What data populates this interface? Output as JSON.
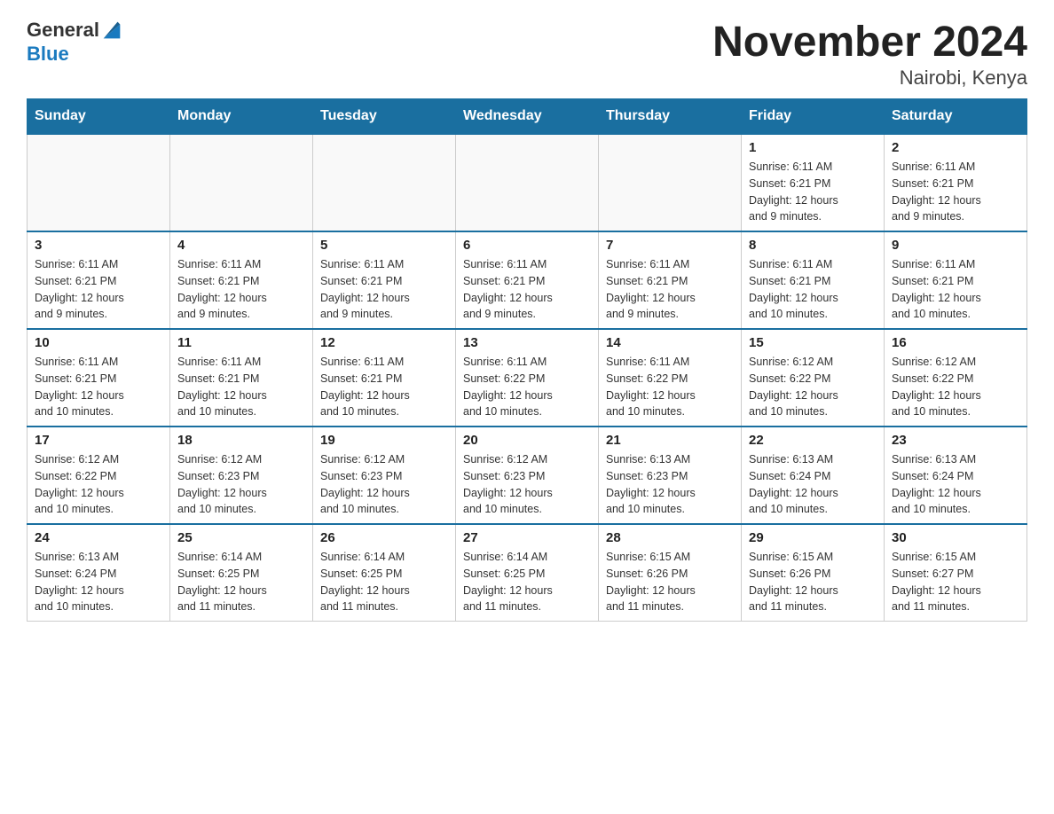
{
  "header": {
    "title": "November 2024",
    "subtitle": "Nairobi, Kenya"
  },
  "logo": {
    "general": "General",
    "blue": "Blue"
  },
  "weekdays": [
    "Sunday",
    "Monday",
    "Tuesday",
    "Wednesday",
    "Thursday",
    "Friday",
    "Saturday"
  ],
  "weeks": [
    [
      {
        "day": "",
        "info": ""
      },
      {
        "day": "",
        "info": ""
      },
      {
        "day": "",
        "info": ""
      },
      {
        "day": "",
        "info": ""
      },
      {
        "day": "",
        "info": ""
      },
      {
        "day": "1",
        "info": "Sunrise: 6:11 AM\nSunset: 6:21 PM\nDaylight: 12 hours\nand 9 minutes."
      },
      {
        "day": "2",
        "info": "Sunrise: 6:11 AM\nSunset: 6:21 PM\nDaylight: 12 hours\nand 9 minutes."
      }
    ],
    [
      {
        "day": "3",
        "info": "Sunrise: 6:11 AM\nSunset: 6:21 PM\nDaylight: 12 hours\nand 9 minutes."
      },
      {
        "day": "4",
        "info": "Sunrise: 6:11 AM\nSunset: 6:21 PM\nDaylight: 12 hours\nand 9 minutes."
      },
      {
        "day": "5",
        "info": "Sunrise: 6:11 AM\nSunset: 6:21 PM\nDaylight: 12 hours\nand 9 minutes."
      },
      {
        "day": "6",
        "info": "Sunrise: 6:11 AM\nSunset: 6:21 PM\nDaylight: 12 hours\nand 9 minutes."
      },
      {
        "day": "7",
        "info": "Sunrise: 6:11 AM\nSunset: 6:21 PM\nDaylight: 12 hours\nand 9 minutes."
      },
      {
        "day": "8",
        "info": "Sunrise: 6:11 AM\nSunset: 6:21 PM\nDaylight: 12 hours\nand 10 minutes."
      },
      {
        "day": "9",
        "info": "Sunrise: 6:11 AM\nSunset: 6:21 PM\nDaylight: 12 hours\nand 10 minutes."
      }
    ],
    [
      {
        "day": "10",
        "info": "Sunrise: 6:11 AM\nSunset: 6:21 PM\nDaylight: 12 hours\nand 10 minutes."
      },
      {
        "day": "11",
        "info": "Sunrise: 6:11 AM\nSunset: 6:21 PM\nDaylight: 12 hours\nand 10 minutes."
      },
      {
        "day": "12",
        "info": "Sunrise: 6:11 AM\nSunset: 6:21 PM\nDaylight: 12 hours\nand 10 minutes."
      },
      {
        "day": "13",
        "info": "Sunrise: 6:11 AM\nSunset: 6:22 PM\nDaylight: 12 hours\nand 10 minutes."
      },
      {
        "day": "14",
        "info": "Sunrise: 6:11 AM\nSunset: 6:22 PM\nDaylight: 12 hours\nand 10 minutes."
      },
      {
        "day": "15",
        "info": "Sunrise: 6:12 AM\nSunset: 6:22 PM\nDaylight: 12 hours\nand 10 minutes."
      },
      {
        "day": "16",
        "info": "Sunrise: 6:12 AM\nSunset: 6:22 PM\nDaylight: 12 hours\nand 10 minutes."
      }
    ],
    [
      {
        "day": "17",
        "info": "Sunrise: 6:12 AM\nSunset: 6:22 PM\nDaylight: 12 hours\nand 10 minutes."
      },
      {
        "day": "18",
        "info": "Sunrise: 6:12 AM\nSunset: 6:23 PM\nDaylight: 12 hours\nand 10 minutes."
      },
      {
        "day": "19",
        "info": "Sunrise: 6:12 AM\nSunset: 6:23 PM\nDaylight: 12 hours\nand 10 minutes."
      },
      {
        "day": "20",
        "info": "Sunrise: 6:12 AM\nSunset: 6:23 PM\nDaylight: 12 hours\nand 10 minutes."
      },
      {
        "day": "21",
        "info": "Sunrise: 6:13 AM\nSunset: 6:23 PM\nDaylight: 12 hours\nand 10 minutes."
      },
      {
        "day": "22",
        "info": "Sunrise: 6:13 AM\nSunset: 6:24 PM\nDaylight: 12 hours\nand 10 minutes."
      },
      {
        "day": "23",
        "info": "Sunrise: 6:13 AM\nSunset: 6:24 PM\nDaylight: 12 hours\nand 10 minutes."
      }
    ],
    [
      {
        "day": "24",
        "info": "Sunrise: 6:13 AM\nSunset: 6:24 PM\nDaylight: 12 hours\nand 10 minutes."
      },
      {
        "day": "25",
        "info": "Sunrise: 6:14 AM\nSunset: 6:25 PM\nDaylight: 12 hours\nand 11 minutes."
      },
      {
        "day": "26",
        "info": "Sunrise: 6:14 AM\nSunset: 6:25 PM\nDaylight: 12 hours\nand 11 minutes."
      },
      {
        "day": "27",
        "info": "Sunrise: 6:14 AM\nSunset: 6:25 PM\nDaylight: 12 hours\nand 11 minutes."
      },
      {
        "day": "28",
        "info": "Sunrise: 6:15 AM\nSunset: 6:26 PM\nDaylight: 12 hours\nand 11 minutes."
      },
      {
        "day": "29",
        "info": "Sunrise: 6:15 AM\nSunset: 6:26 PM\nDaylight: 12 hours\nand 11 minutes."
      },
      {
        "day": "30",
        "info": "Sunrise: 6:15 AM\nSunset: 6:27 PM\nDaylight: 12 hours\nand 11 minutes."
      }
    ]
  ]
}
